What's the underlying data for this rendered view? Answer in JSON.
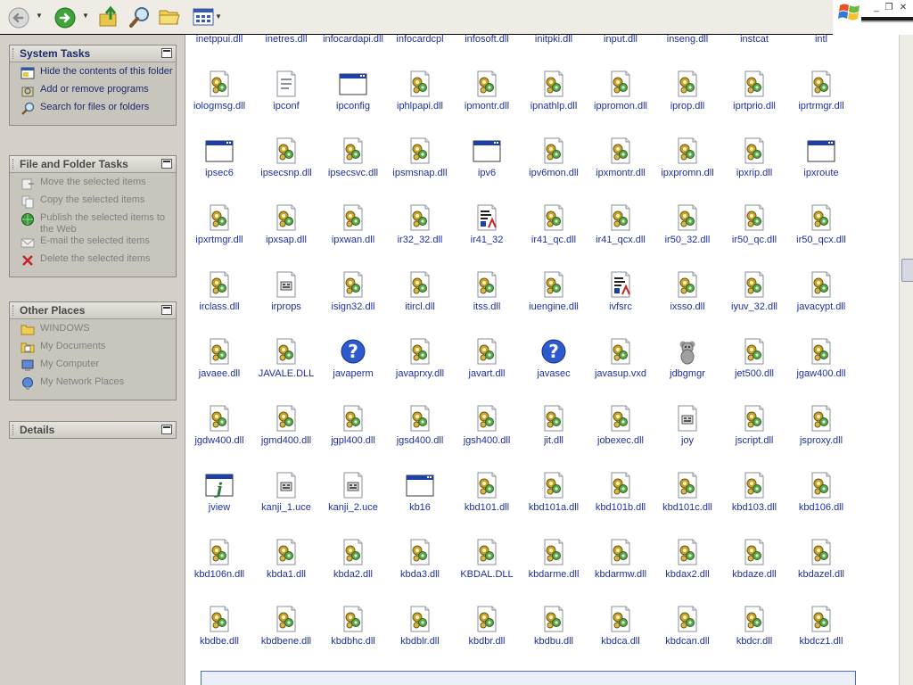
{
  "toolbar": {
    "buttons": [
      {
        "name": "back-button",
        "icon": "back-arrow-icon"
      },
      {
        "name": "forward-button",
        "icon": "forward-arrow-icon"
      },
      {
        "name": "up-folder-button",
        "icon": "up-folder-icon"
      },
      {
        "name": "search-button",
        "icon": "search-icon"
      },
      {
        "name": "folders-button",
        "icon": "folder-icon"
      },
      {
        "name": "views-button",
        "icon": "views-icon"
      }
    ],
    "window_controls": [
      "_",
      "❐",
      "✕"
    ]
  },
  "taskpane": {
    "system_tasks": {
      "title": "System Tasks",
      "items": [
        {
          "label": "Hide the contents of this folder",
          "icon": "hide-contents-icon"
        },
        {
          "label": "Add or remove programs",
          "icon": "add-remove-programs-icon"
        },
        {
          "label": "Search for files or folders",
          "icon": "search-icon"
        }
      ]
    },
    "file_folder_tasks": {
      "title": "File and Folder Tasks",
      "items": [
        {
          "label": "Move the selected items",
          "icon": "move-icon"
        },
        {
          "label": "Copy the selected items",
          "icon": "copy-icon"
        },
        {
          "label": "Publish the selected items to the Web",
          "icon": "globe-icon"
        },
        {
          "label": "E-mail the selected items",
          "icon": "email-icon"
        },
        {
          "label": "Delete the selected items",
          "icon": "delete-icon"
        }
      ]
    },
    "other_places": {
      "title": "Other Places",
      "items": [
        {
          "label": "WINDOWS",
          "icon": "folder-icon"
        },
        {
          "label": "My Documents",
          "icon": "my-documents-icon"
        },
        {
          "label": "My Computer",
          "icon": "my-computer-icon"
        },
        {
          "label": "My Network Places",
          "icon": "network-places-icon"
        }
      ]
    },
    "details": {
      "title": "Details"
    }
  },
  "files": {
    "rows": [
      [
        {
          "name": "inetppui.dll",
          "type": "dll"
        },
        {
          "name": "inetres.dll",
          "type": "dll"
        },
        {
          "name": "infocardapi.dll",
          "type": "dll"
        },
        {
          "name": "infocardcpl",
          "type": "doc"
        },
        {
          "name": "infosoft.dll",
          "type": "dll"
        },
        {
          "name": "initpki.dll",
          "type": "dll"
        },
        {
          "name": "input.dll",
          "type": "dll"
        },
        {
          "name": "inseng.dll",
          "type": "dll"
        },
        {
          "name": "instcat",
          "type": "cat"
        },
        {
          "name": "intl",
          "type": "doc"
        }
      ],
      [
        {
          "name": "iologmsg.dll",
          "type": "dll"
        },
        {
          "name": "ipconf",
          "type": "doc"
        },
        {
          "name": "ipconfig",
          "type": "exe"
        },
        {
          "name": "iphlpapi.dll",
          "type": "dll"
        },
        {
          "name": "ipmontr.dll",
          "type": "dll"
        },
        {
          "name": "ipnathlp.dll",
          "type": "dll"
        },
        {
          "name": "ippromon.dll",
          "type": "dll"
        },
        {
          "name": "iprop.dll",
          "type": "dll"
        },
        {
          "name": "iprtprio.dll",
          "type": "dll"
        },
        {
          "name": "iprtrmgr.dll",
          "type": "dll"
        }
      ],
      [
        {
          "name": "ipsec6",
          "type": "exe"
        },
        {
          "name": "ipsecsnp.dll",
          "type": "dll"
        },
        {
          "name": "ipsecsvc.dll",
          "type": "dll"
        },
        {
          "name": "ipsmsnap.dll",
          "type": "dll"
        },
        {
          "name": "ipv6",
          "type": "exe"
        },
        {
          "name": "ipv6mon.dll",
          "type": "dll"
        },
        {
          "name": "ipxmontr.dll",
          "type": "dll"
        },
        {
          "name": "ipxpromn.dll",
          "type": "dll"
        },
        {
          "name": "ipxrip.dll",
          "type": "dll"
        },
        {
          "name": "ipxroute",
          "type": "exe"
        }
      ],
      [
        {
          "name": "ipxrtmgr.dll",
          "type": "dll"
        },
        {
          "name": "ipxsap.dll",
          "type": "dll"
        },
        {
          "name": "ipxwan.dll",
          "type": "dll"
        },
        {
          "name": "ir32_32.dll",
          "type": "dll"
        },
        {
          "name": "ir41_32",
          "type": "ax"
        },
        {
          "name": "ir41_qc.dll",
          "type": "dll"
        },
        {
          "name": "ir41_qcx.dll",
          "type": "dll"
        },
        {
          "name": "ir50_32.dll",
          "type": "dll"
        },
        {
          "name": "ir50_qc.dll",
          "type": "dll"
        },
        {
          "name": "ir50_qcx.dll",
          "type": "dll"
        }
      ],
      [
        {
          "name": "irclass.dll",
          "type": "dll"
        },
        {
          "name": "irprops",
          "type": "cpl"
        },
        {
          "name": "isign32.dll",
          "type": "dll"
        },
        {
          "name": "itircl.dll",
          "type": "dll"
        },
        {
          "name": "itss.dll",
          "type": "dll"
        },
        {
          "name": "iuengine.dll",
          "type": "dll"
        },
        {
          "name": "ivfsrc",
          "type": "ax"
        },
        {
          "name": "ixsso.dll",
          "type": "dll"
        },
        {
          "name": "iyuv_32.dll",
          "type": "dll"
        },
        {
          "name": "javacypt.dll",
          "type": "dll"
        }
      ],
      [
        {
          "name": "javaee.dll",
          "type": "dll"
        },
        {
          "name": "JAVALE.DLL",
          "type": "dll"
        },
        {
          "name": "javaperm",
          "type": "help"
        },
        {
          "name": "javaprxy.dll",
          "type": "dll"
        },
        {
          "name": "javart.dll",
          "type": "dll"
        },
        {
          "name": "javasec",
          "type": "help"
        },
        {
          "name": "javasup.vxd",
          "type": "dll"
        },
        {
          "name": "jdbgmgr",
          "type": "bear"
        },
        {
          "name": "jet500.dll",
          "type": "dll"
        },
        {
          "name": "jgaw400.dll",
          "type": "dll"
        }
      ],
      [
        {
          "name": "jgdw400.dll",
          "type": "dll"
        },
        {
          "name": "jgmd400.dll",
          "type": "dll"
        },
        {
          "name": "jgpl400.dll",
          "type": "dll"
        },
        {
          "name": "jgsd400.dll",
          "type": "dll"
        },
        {
          "name": "jgsh400.dll",
          "type": "dll"
        },
        {
          "name": "jit.dll",
          "type": "dll"
        },
        {
          "name": "jobexec.dll",
          "type": "dll"
        },
        {
          "name": "joy",
          "type": "cpl"
        },
        {
          "name": "jscript.dll",
          "type": "dll"
        },
        {
          "name": "jsproxy.dll",
          "type": "dll"
        }
      ],
      [
        {
          "name": "jview",
          "type": "jview"
        },
        {
          "name": "kanji_1.uce",
          "type": "cpl"
        },
        {
          "name": "kanji_2.uce",
          "type": "cpl"
        },
        {
          "name": "kb16",
          "type": "exe"
        },
        {
          "name": "kbd101.dll",
          "type": "dll"
        },
        {
          "name": "kbd101a.dll",
          "type": "dll"
        },
        {
          "name": "kbd101b.dll",
          "type": "dll"
        },
        {
          "name": "kbd101c.dll",
          "type": "dll"
        },
        {
          "name": "kbd103.dll",
          "type": "dll"
        },
        {
          "name": "kbd106.dll",
          "type": "dll"
        }
      ],
      [
        {
          "name": "kbd106n.dll",
          "type": "dll"
        },
        {
          "name": "kbda1.dll",
          "type": "dll"
        },
        {
          "name": "kbda2.dll",
          "type": "dll"
        },
        {
          "name": "kbda3.dll",
          "type": "dll"
        },
        {
          "name": "KBDAL.DLL",
          "type": "dll"
        },
        {
          "name": "kbdarme.dll",
          "type": "dll"
        },
        {
          "name": "kbdarmw.dll",
          "type": "dll"
        },
        {
          "name": "kbdax2.dll",
          "type": "dll"
        },
        {
          "name": "kbdaze.dll",
          "type": "dll"
        },
        {
          "name": "kbdazel.dll",
          "type": "dll"
        }
      ],
      [
        {
          "name": "kbdbe.dll",
          "type": "dll"
        },
        {
          "name": "kbdbene.dll",
          "type": "dll"
        },
        {
          "name": "kbdbhc.dll",
          "type": "dll"
        },
        {
          "name": "kbdblr.dll",
          "type": "dll"
        },
        {
          "name": "kbdbr.dll",
          "type": "dll"
        },
        {
          "name": "kbdbu.dll",
          "type": "dll"
        },
        {
          "name": "kbdca.dll",
          "type": "dll"
        },
        {
          "name": "kbdcan.dll",
          "type": "dll"
        },
        {
          "name": "kbdcr.dll",
          "type": "dll"
        },
        {
          "name": "kbdcz1.dll",
          "type": "dll"
        }
      ]
    ]
  }
}
